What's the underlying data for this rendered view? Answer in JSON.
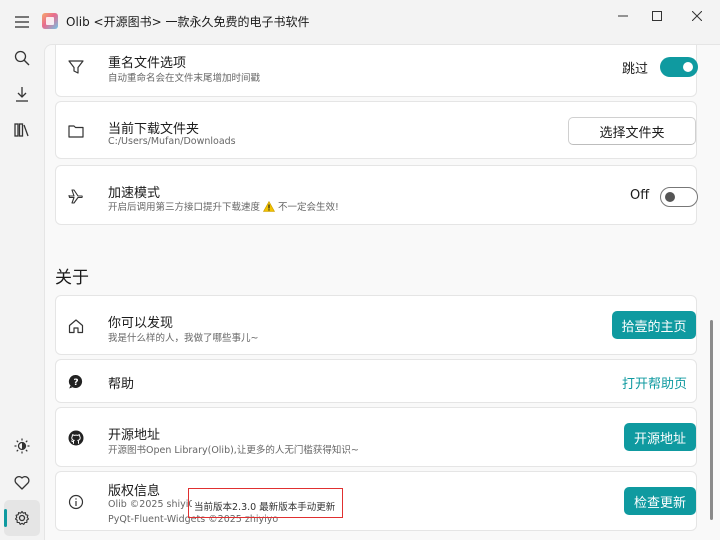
{
  "window": {
    "title": "Olib <开源图书> 一款永久免费的电子书软件",
    "controls": [
      "minimize",
      "maximize",
      "close"
    ]
  },
  "nav": {
    "top_icons": [
      "menu-icon",
      "search-icon",
      "download-icon",
      "library-icon"
    ],
    "bottom_icons": [
      "theme-icon",
      "heart-icon",
      "settings-icon"
    ],
    "active": "settings"
  },
  "settings": {
    "rename": {
      "title": "重名文件选项",
      "subtitle": "自动重命名会在文件末尾增加时间戳",
      "toggle_label": "跳过",
      "toggle_on": true
    },
    "download_folder": {
      "title": "当前下载文件夹",
      "subtitle": "C:/Users/Mufan/Downloads",
      "button": "选择文件夹"
    },
    "speed": {
      "title": "加速模式",
      "subtitle": "开启后调用第三方接口提升下载速度",
      "warning": "不一定会生效!",
      "toggle_label": "Off",
      "toggle_on": false
    }
  },
  "about": {
    "section_title": "关于",
    "discover": {
      "title": "你可以发现",
      "subtitle": "我是什么样的人，我做了哪些事儿~",
      "button": "拾壹的主页"
    },
    "help": {
      "title": "帮助",
      "button": "打开帮助页"
    },
    "source": {
      "title": "开源地址",
      "subtitle": "开源图书Open Library(Olib),让更多的人无门槛获得知识~",
      "button": "开源地址"
    },
    "copyright": {
      "title": "版权信息",
      "line1": "Olib ©2025 shiyi0x7f",
      "version_note": "当前版本2.3.0 最新版本手动更新",
      "line2": "PyQt-Fluent-Widgets ©2025  zhiyiyo",
      "button": "检查更新"
    }
  },
  "colors": {
    "accent": "#0f9aa0",
    "annotation_box": "#e03030"
  }
}
